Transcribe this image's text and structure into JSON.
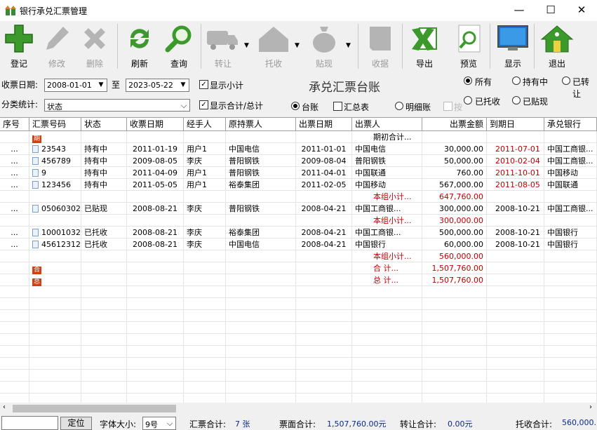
{
  "window": {
    "title": "银行承兑汇票管理",
    "minimize": "—",
    "maximize": "☐",
    "close": "✕"
  },
  "toolbar": {
    "items": [
      {
        "label": "登记",
        "icon": "plus-icon",
        "enabled": true
      },
      {
        "label": "修改",
        "icon": "pencil-icon",
        "enabled": false
      },
      {
        "label": "删除",
        "icon": "delete-x-icon",
        "enabled": false
      },
      {
        "label": "刷新",
        "icon": "refresh-icon",
        "enabled": true
      },
      {
        "label": "查询",
        "icon": "magnifier-icon",
        "enabled": true
      },
      {
        "label": "转让",
        "icon": "truck-icon",
        "enabled": false
      },
      {
        "label": "托收",
        "icon": "house-icon",
        "enabled": false
      },
      {
        "label": "贴现",
        "icon": "money-bag-icon",
        "enabled": false
      },
      {
        "label": "收据",
        "icon": "receipt-icon",
        "enabled": false
      },
      {
        "label": "导出",
        "icon": "excel-icon",
        "enabled": true
      },
      {
        "label": "预览",
        "icon": "preview-icon",
        "enabled": true
      },
      {
        "label": "显示",
        "icon": "monitor-icon",
        "enabled": true
      },
      {
        "label": "退出",
        "icon": "exit-house-icon",
        "enabled": true
      }
    ]
  },
  "filters": {
    "date_label": "收票日期:",
    "date_from": "2008-01-01",
    "to_label": "至",
    "date_to": "2023-05-22",
    "show_subtotal": "显示小计",
    "category_label": "分类统计:",
    "category_value": "状态",
    "show_total": "显示合计/总计",
    "view_ledger": "台账",
    "view_summary": "汇总表",
    "view_detail": "明细账",
    "by_period": "按...",
    "status_all": "所有",
    "status_holding": "持有中",
    "status_transferred": "已转让",
    "status_collecting": "已托收",
    "status_discounted": "已贴现"
  },
  "heading": "承兑汇票台账",
  "columns": [
    "序号",
    "汇票号码",
    "状态",
    "收票日期",
    "经手人",
    "原持票人",
    "出票日期",
    "出票人",
    "出票金额",
    "到期日",
    "承兑银行"
  ],
  "rows": [
    {
      "kind": "mark",
      "mark": "期",
      "payer": "期初合计..."
    },
    {
      "kind": "data",
      "seq": "...",
      "no": "23543",
      "status": "持有中",
      "recv": "2011-01-19",
      "handler": "用户1",
      "orig": "中国电信",
      "issue": "2011-01-01",
      "payer": "中国电信",
      "amount": "30,000.00",
      "due": "2011-07-01",
      "due_red": true,
      "bank": "中国工商银..."
    },
    {
      "kind": "data",
      "seq": "...",
      "no": "456789",
      "status": "持有中",
      "recv": "2009-08-05",
      "handler": "李庆",
      "orig": "普阳钢铁",
      "issue": "2009-08-04",
      "payer": "普阳钢铁",
      "amount": "50,000.00",
      "due": "2010-02-04",
      "due_red": true,
      "bank": "中国工商银..."
    },
    {
      "kind": "data",
      "seq": "...",
      "no": "9",
      "status": "持有中",
      "recv": "2011-04-09",
      "handler": "用户1",
      "orig": "普阳钢铁",
      "issue": "2011-04-01",
      "payer": "中国联通",
      "amount": "760.00",
      "due": "2011-10-01",
      "due_red": true,
      "bank": "中国移动"
    },
    {
      "kind": "data",
      "seq": "...",
      "no": "123456",
      "status": "持有中",
      "recv": "2011-05-05",
      "handler": "用户1",
      "orig": "裕泰集团",
      "issue": "2011-02-05",
      "payer": "中国移动",
      "amount": "567,000.00",
      "due": "2011-08-05",
      "due_red": true,
      "bank": "中国联通"
    },
    {
      "kind": "sub",
      "payer": "本组小计...",
      "amount": "647,760.00"
    },
    {
      "kind": "data",
      "seq": "...",
      "no": "05060302",
      "status": "已贴现",
      "recv": "2008-08-21",
      "handler": "李庆",
      "orig": "普阳钢铁",
      "issue": "2008-04-21",
      "payer": "中国工商银...",
      "amount": "300,000.00",
      "due": "2008-10-21",
      "due_red": false,
      "bank": "中国工商银..."
    },
    {
      "kind": "sub",
      "payer": "本组小计...",
      "amount": "300,000.00"
    },
    {
      "kind": "data",
      "seq": "...",
      "no": "10001032",
      "status": "已托收",
      "recv": "2008-08-21",
      "handler": "李庆",
      "orig": "裕泰集团",
      "issue": "2008-04-21",
      "payer": "中国工商银...",
      "amount": "500,000.00",
      "due": "2008-10-21",
      "due_red": false,
      "bank": "中国银行"
    },
    {
      "kind": "data",
      "seq": "...",
      "no": "45612312",
      "status": "已托收",
      "recv": "2008-08-21",
      "handler": "李庆",
      "orig": "中国电信",
      "issue": "2008-04-21",
      "payer": "中国银行",
      "amount": "60,000.00",
      "due": "2008-10-21",
      "due_red": false,
      "bank": "中国银行"
    },
    {
      "kind": "sub",
      "payer": "本组小计...",
      "amount": "560,000.00"
    },
    {
      "kind": "total",
      "mark": "合",
      "payer": "合    计...",
      "amount": "1,507,760.00"
    },
    {
      "kind": "total",
      "mark": "总",
      "payer": "总    计...",
      "amount": "1,507,760.00"
    }
  ],
  "status": {
    "locate_value": "",
    "locate_button": "定位",
    "font_label": "字体大小:",
    "font_value": "9号",
    "count_label": "汇票合计:",
    "count_value": "7 张",
    "face_label": "票面合计:",
    "face_value": "1,507,760.00元",
    "transfer_label": "转让合计:",
    "transfer_value": "0.00元",
    "collect_label": "托收合计:",
    "collect_value": "560,000."
  },
  "colors": {
    "accent_green": "#2f8f2f",
    "red_text": "#c00000",
    "blue_text": "#0a2a8a"
  }
}
